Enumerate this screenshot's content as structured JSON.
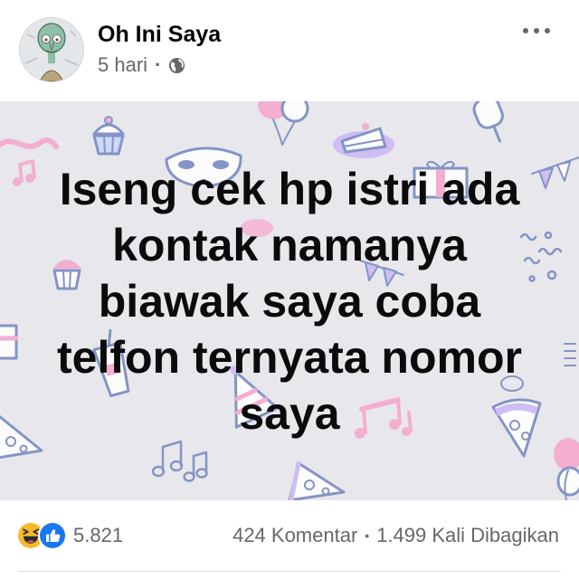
{
  "post": {
    "author": "Oh Ini Saya",
    "time": "5 hari",
    "separator": "·",
    "privacy_icon": "globe-icon",
    "more_icon": "more-options-icon",
    "image_text_lines": [
      "Iseng cek hp istri ada",
      "kontak namanya",
      "biawak saya coba",
      "telfon ternyata nomor",
      "saya"
    ]
  },
  "reactions": {
    "icons": [
      "haha-reaction-icon",
      "like-reaction-icon"
    ],
    "count": "5.821"
  },
  "stats": {
    "comments": "424 Komentar",
    "separator": "•",
    "shares": "1.499 Kali Dibagikan"
  },
  "colors": {
    "bg": "#ffffff",
    "text-primary": "#050505",
    "text-secondary": "#65676b",
    "image-bg": "#e8e8ec",
    "caption": "#0b0b0b",
    "outline": "#7a8cc2",
    "pink": "#f5a8cd",
    "lavender": "#cdb9f4",
    "like-blue": "#1877f2",
    "haha-yellow": "#f7b928"
  }
}
